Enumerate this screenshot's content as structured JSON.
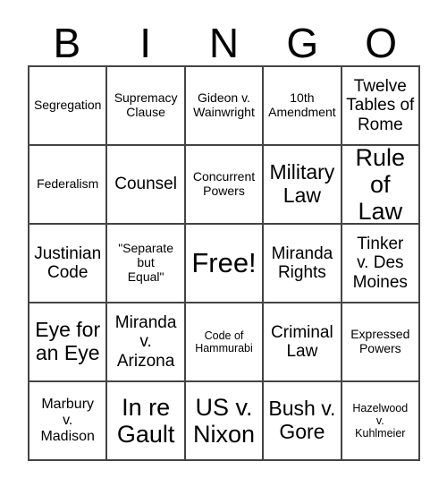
{
  "card": {
    "title_letters": [
      "B",
      "I",
      "N",
      "G",
      "O"
    ],
    "rows": [
      [
        {
          "text": "Segregation",
          "size": "sm"
        },
        {
          "text": "Supremacy\nClause",
          "size": "sm"
        },
        {
          "text": "Gideon v.\nWainwright",
          "size": "sm"
        },
        {
          "text": "10th\nAmendment",
          "size": "sm"
        },
        {
          "text": "Twelve\nTables of\nRome",
          "size": "lg"
        }
      ],
      [
        {
          "text": "Federalism",
          "size": "sm"
        },
        {
          "text": "Counsel",
          "size": "lg"
        },
        {
          "text": "Concurrent\nPowers",
          "size": "sm"
        },
        {
          "text": "Military\nLaw",
          "size": "xl"
        },
        {
          "text": "Rule\nof Law",
          "size": "xxl"
        }
      ],
      [
        {
          "text": "Justinian\nCode",
          "size": "lg"
        },
        {
          "text": "\"Separate\nbut\nEqual\"",
          "size": "sm"
        },
        {
          "text": "Free!",
          "size": "free"
        },
        {
          "text": "Miranda\nRights",
          "size": "lg"
        },
        {
          "text": "Tinker\nv. Des\nMoines",
          "size": "lg"
        }
      ],
      [
        {
          "text": "Eye for\nan Eye",
          "size": "xl"
        },
        {
          "text": "Miranda\nv.\nArizona",
          "size": "lg"
        },
        {
          "text": "Code of\nHammurabi",
          "size": "xs"
        },
        {
          "text": "Criminal\nLaw",
          "size": "lg"
        },
        {
          "text": "Expressed\nPowers",
          "size": "sm"
        }
      ],
      [
        {
          "text": "Marbury\nv.\nMadison",
          "size": "md"
        },
        {
          "text": "In re\nGault",
          "size": "xxl"
        },
        {
          "text": "US v.\nNixon",
          "size": "xxl"
        },
        {
          "text": "Bush v.\nGore",
          "size": "xl"
        },
        {
          "text": "Hazelwood\nv.\nKuhlmeier",
          "size": "xs"
        }
      ]
    ]
  }
}
